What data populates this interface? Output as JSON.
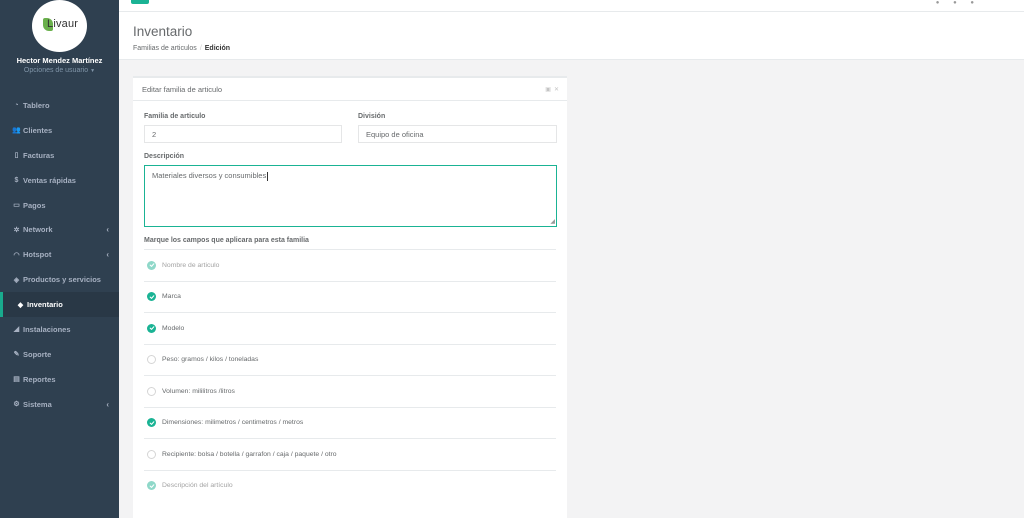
{
  "profile": {
    "logo_text": "Livaur",
    "name": "Hector Mendez Martínez",
    "options": "Opciones de usuario"
  },
  "nav": {
    "items": [
      {
        "label": "Tablero",
        "icon": "dashboard-icon",
        "glyph": "◔",
        "active": false,
        "arrow": false
      },
      {
        "label": "Clientes",
        "icon": "users-icon",
        "glyph": "👥",
        "active": false,
        "arrow": false
      },
      {
        "label": "Facturas",
        "icon": "file-icon",
        "glyph": "▯",
        "active": false,
        "arrow": false
      },
      {
        "label": "Ventas rápidas",
        "icon": "dollar-icon",
        "glyph": "$",
        "active": false,
        "arrow": false
      },
      {
        "label": "Pagos",
        "icon": "money-icon",
        "glyph": "▭",
        "active": false,
        "arrow": false
      },
      {
        "label": "Network",
        "icon": "network-icon",
        "glyph": "✲",
        "active": false,
        "arrow": true
      },
      {
        "label": "Hotspot",
        "icon": "wifi-icon",
        "glyph": "◠",
        "active": false,
        "arrow": true
      },
      {
        "label": "Productos y servicios",
        "icon": "tag-icon",
        "glyph": "◈",
        "active": false,
        "arrow": false
      },
      {
        "label": "Inventario",
        "icon": "cubes-icon",
        "glyph": "◆",
        "active": true,
        "arrow": false
      },
      {
        "label": "Instalaciones",
        "icon": "plug-icon",
        "glyph": "◢",
        "active": false,
        "arrow": false
      },
      {
        "label": "Soporte",
        "icon": "wrench-icon",
        "glyph": "✎",
        "active": false,
        "arrow": false
      },
      {
        "label": "Reportes",
        "icon": "book-icon",
        "glyph": "▤",
        "active": false,
        "arrow": false
      },
      {
        "label": "Sistema",
        "icon": "gears-icon",
        "glyph": "⚙",
        "active": false,
        "arrow": true
      }
    ]
  },
  "heading": {
    "title": "Inventario",
    "breadcrumb_parent": "Familias de articulos",
    "breadcrumb_current": "Edición"
  },
  "panel": {
    "title": "Editar familia de articulo"
  },
  "form": {
    "familia_label": "Familia de articulo",
    "familia_value": "2",
    "division_label": "División",
    "division_value": "Equipo de oficina",
    "descripcion_label": "Descripción",
    "descripcion_value": "Materiales diversos y consumibles",
    "campos_label": "Marque los campos que aplicara para esta familia"
  },
  "checks": [
    {
      "label": "Nombre de articulo",
      "checked": true,
      "disabled": true
    },
    {
      "label": "Marca",
      "checked": true,
      "disabled": false
    },
    {
      "label": "Modelo",
      "checked": true,
      "disabled": false
    },
    {
      "label": "Peso: gramos / kilos / toneladas",
      "checked": false,
      "disabled": false
    },
    {
      "label": "Volumen: mililitros /litros",
      "checked": false,
      "disabled": false
    },
    {
      "label": "Dimensiones: milimetros / centimetros / metros",
      "checked": true,
      "disabled": false
    },
    {
      "label": "Recipiente: bolsa / botella / garrafon / caja / paquete / otro",
      "checked": false,
      "disabled": false
    },
    {
      "label": "Descripción del artículo",
      "checked": true,
      "disabled": true
    }
  ],
  "colors": {
    "sidebar": "#2f4050",
    "accent": "#1ab394"
  }
}
